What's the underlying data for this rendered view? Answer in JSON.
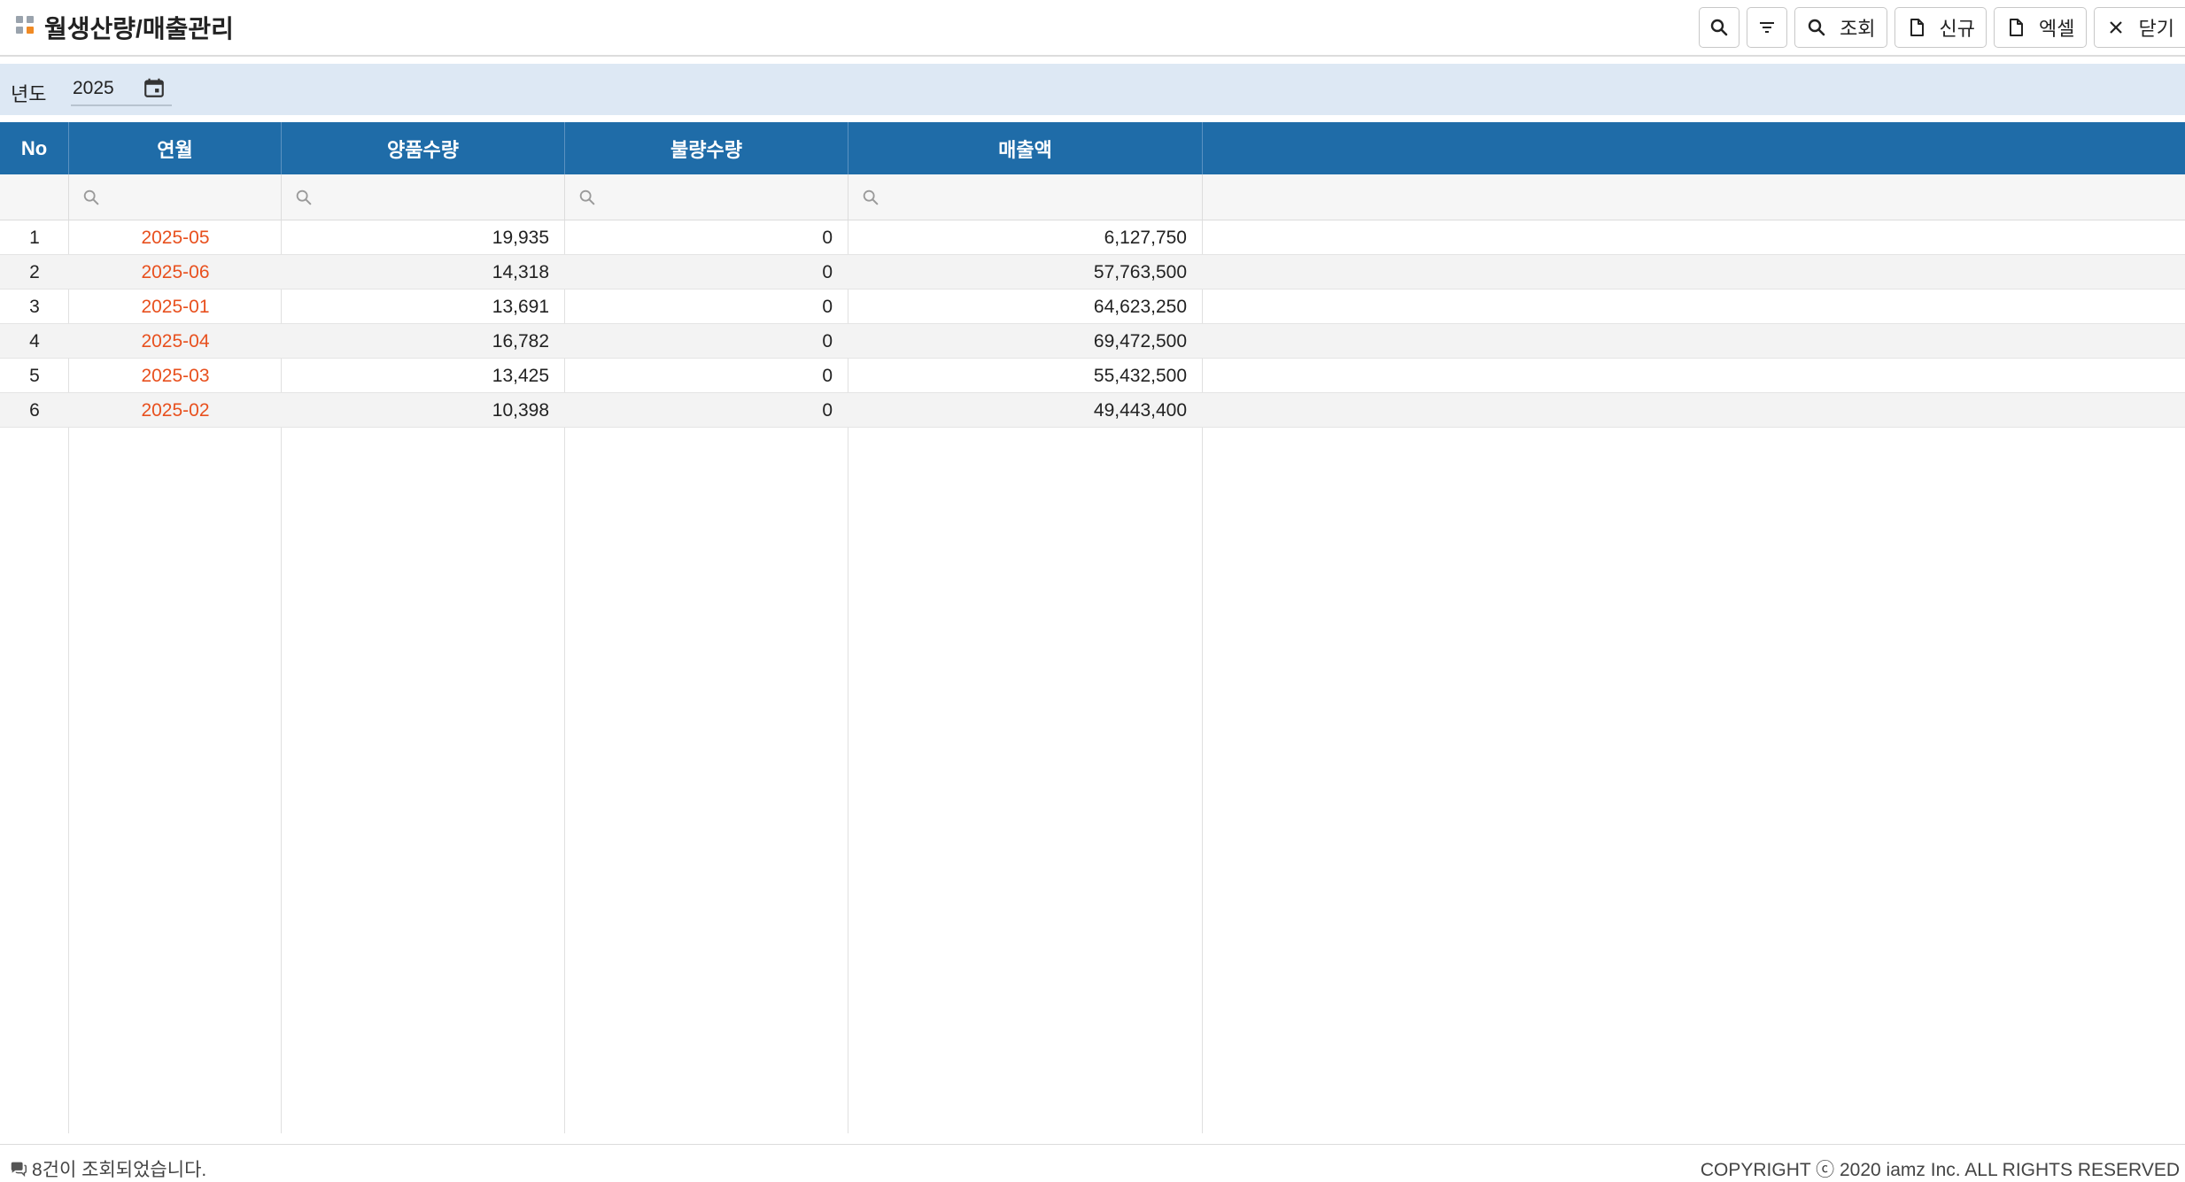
{
  "header": {
    "title": "월생산량/매출관리",
    "toolbar": {
      "search_label": "조회",
      "new_label": "신규",
      "excel_label": "엑셀",
      "close_label": "닫기"
    }
  },
  "filter": {
    "year_label": "년도",
    "year_value": "2025"
  },
  "grid": {
    "columns": [
      "No",
      "연월",
      "양품수량",
      "불량수량",
      "매출액"
    ],
    "rows": [
      {
        "no": "1",
        "ym": "2025-05",
        "good": "19,935",
        "bad": "0",
        "sales": "6,127,750"
      },
      {
        "no": "2",
        "ym": "2025-06",
        "good": "14,318",
        "bad": "0",
        "sales": "57,763,500"
      },
      {
        "no": "3",
        "ym": "2025-01",
        "good": "13,691",
        "bad": "0",
        "sales": "64,623,250"
      },
      {
        "no": "4",
        "ym": "2025-04",
        "good": "16,782",
        "bad": "0",
        "sales": "69,472,500"
      },
      {
        "no": "5",
        "ym": "2025-03",
        "good": "13,425",
        "bad": "0",
        "sales": "55,432,500"
      },
      {
        "no": "6",
        "ym": "2025-02",
        "good": "10,398",
        "bad": "0",
        "sales": "49,443,400"
      }
    ]
  },
  "footer": {
    "status": "8건이 조회되었습니다.",
    "copyright": "COPYRIGHT ⓒ 2020 iamz Inc. ALL RIGHTS RESERVED"
  },
  "colors": {
    "header_bg": "#1f6ca8",
    "filter_bar_bg": "#dde8f4",
    "month_text": "#e8501e",
    "title_icon_accent": "#f08a24"
  }
}
